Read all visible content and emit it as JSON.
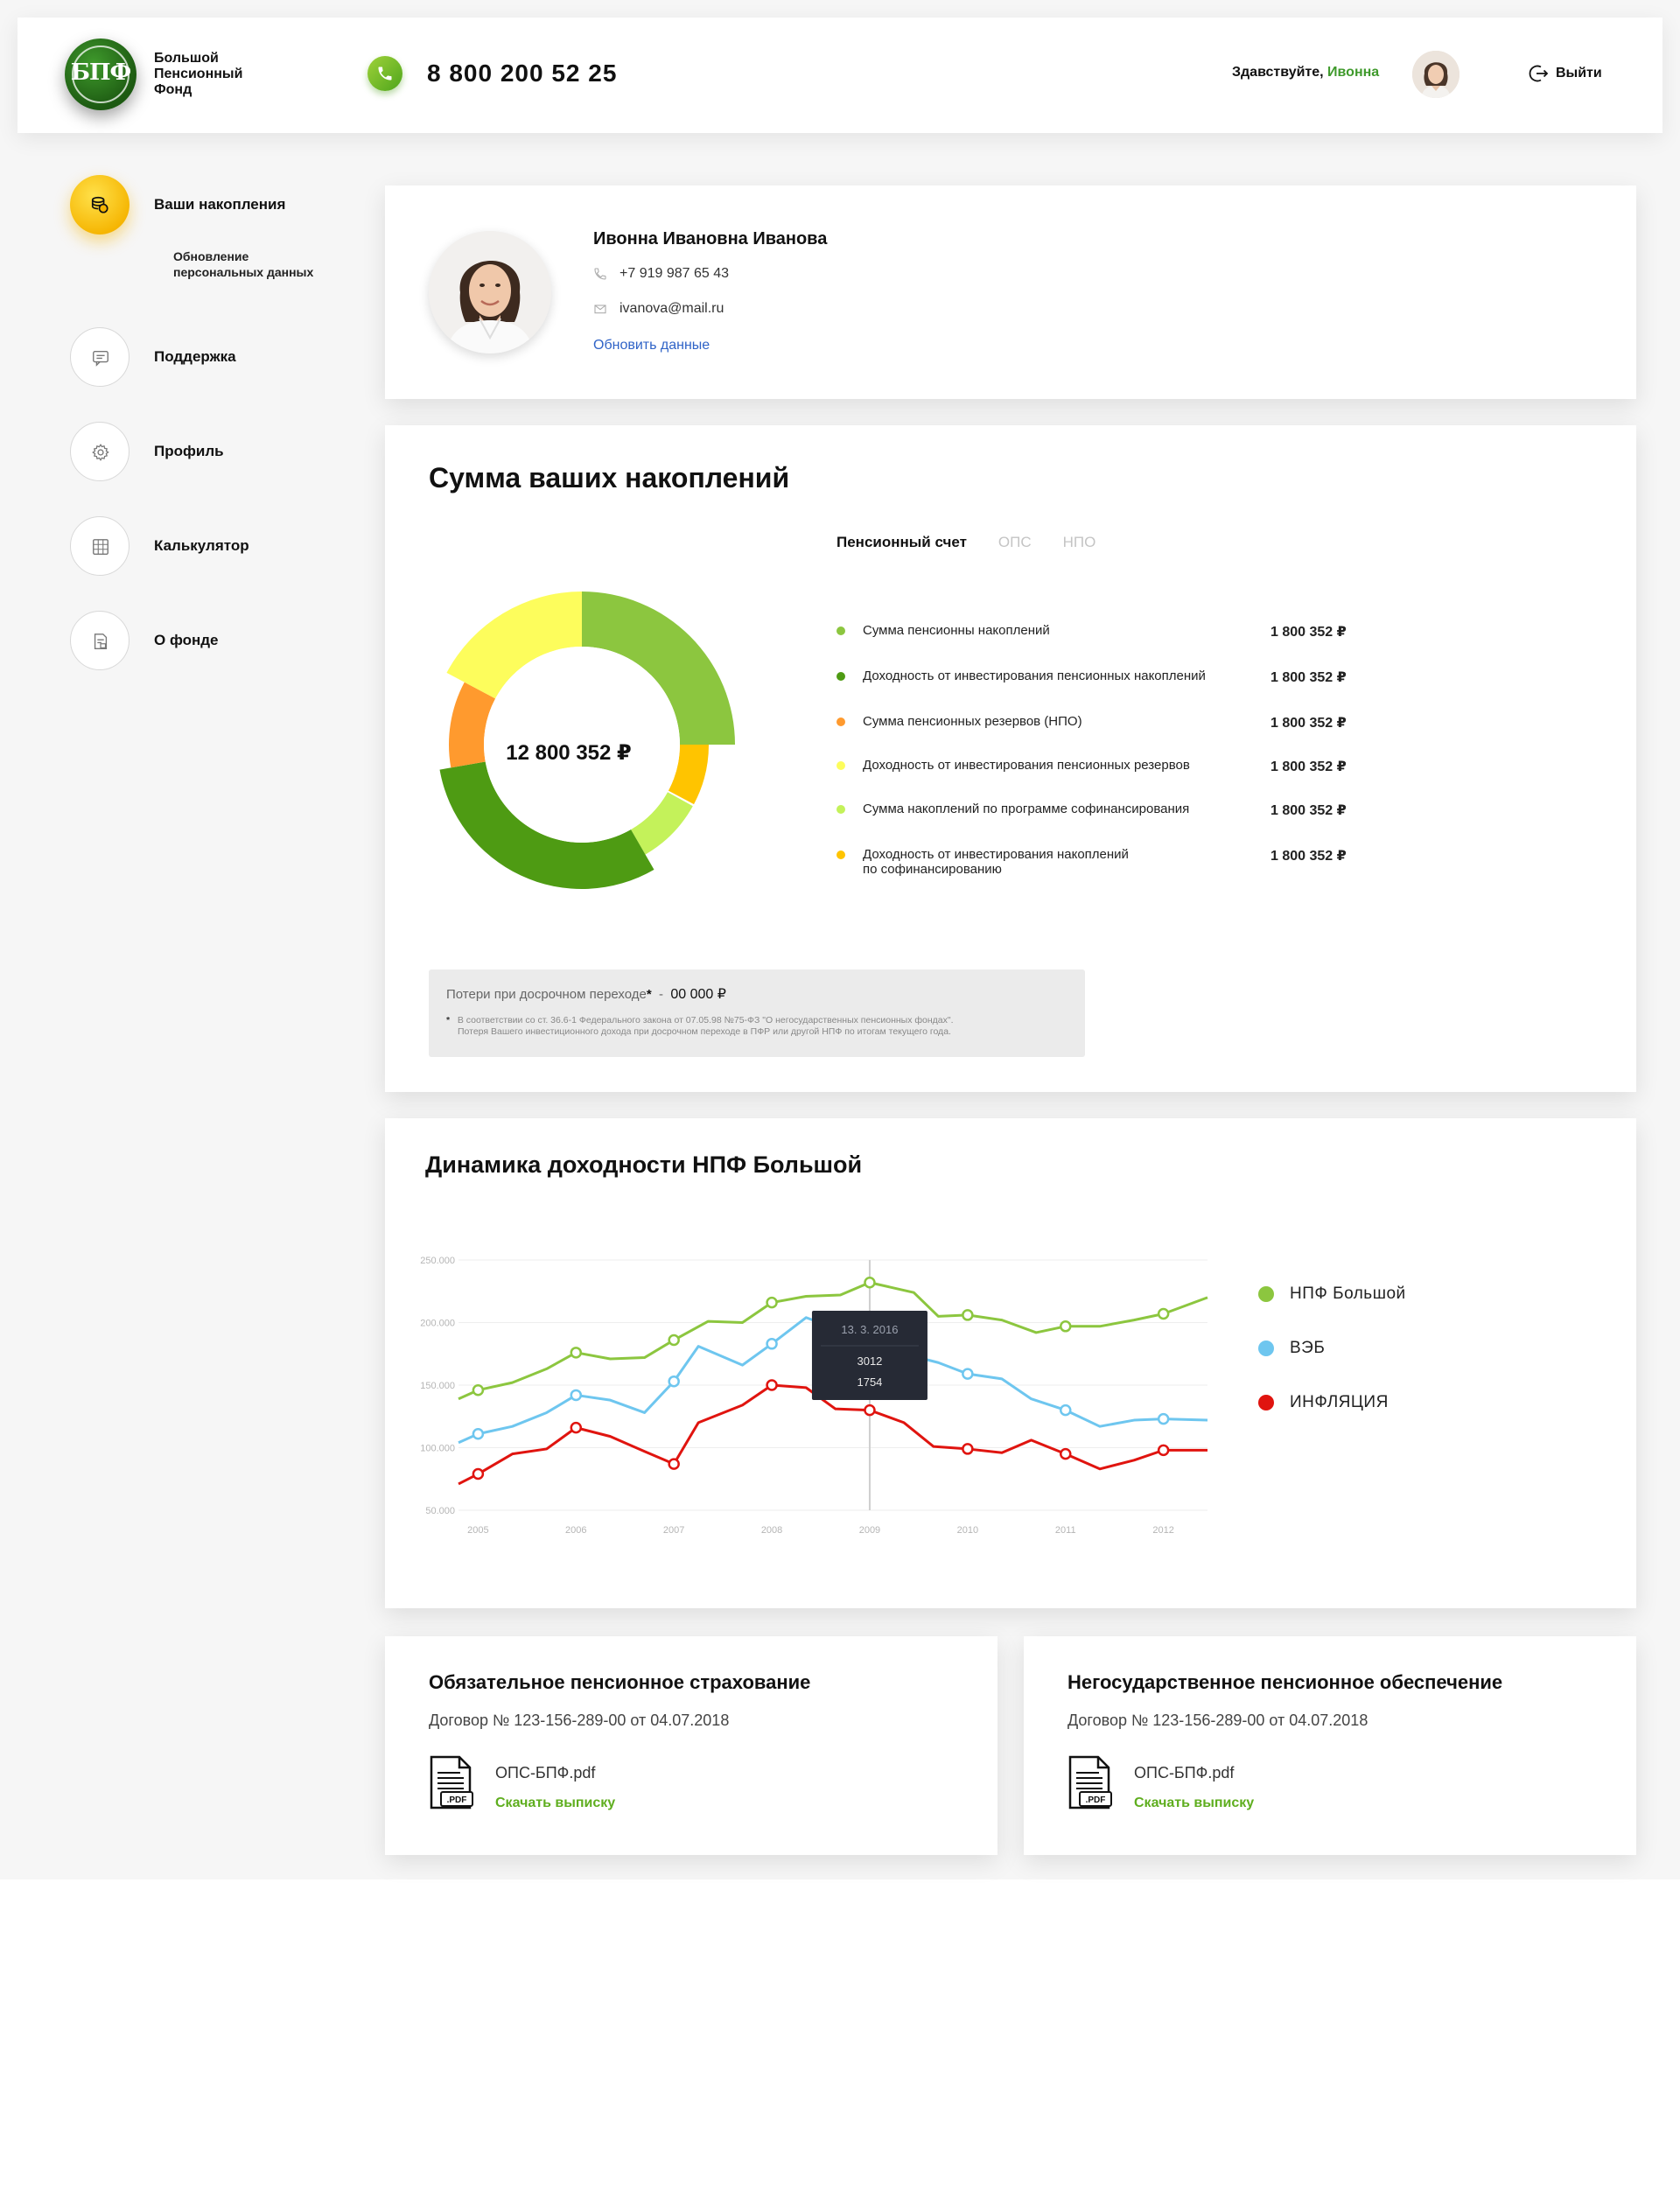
{
  "header": {
    "brand_lines": [
      "Большой",
      "Пенсионный",
      "Фонд"
    ],
    "logo_mark": "БПФ",
    "phone": "8 800 200 52 25",
    "greeting": "Здавствуйте, ",
    "user_first_name": "Ивонна",
    "logout_label": "Выйти"
  },
  "sidebar": {
    "items": [
      {
        "label": "Ваши накопления",
        "icon": "coins-icon",
        "active": true
      },
      {
        "label": "Поддержка",
        "icon": "chat-icon"
      },
      {
        "label": "Профиль",
        "icon": "gear-icon"
      },
      {
        "label": "Калькулятор",
        "icon": "calculator-icon"
      },
      {
        "label": "О фонде",
        "icon": "document-icon"
      }
    ],
    "subitem_lines": [
      "Обновление",
      "персональных данных"
    ]
  },
  "profile": {
    "full_name": "Ивонна Ивановна Иванова",
    "phone": "+7 919 987 65 43",
    "email": "ivanova@mail.ru",
    "update_link": "Обновить данные"
  },
  "savings": {
    "title": "Сумма ваших накоплений",
    "tabs": [
      {
        "label": "Пенсионный счет",
        "active": true
      },
      {
        "label": "ОПС",
        "active": false
      },
      {
        "label": "НПО",
        "active": false
      }
    ],
    "total": "12 800 352 ₽",
    "items": [
      {
        "label": "Сумма пенсионны накоплений",
        "value": "1 800 352 ₽",
        "color": "#8cc63f"
      },
      {
        "label": "Доходность от инвестирования пенсионных накоплений",
        "value": "1 800 352 ₽",
        "color": "#4e9b13"
      },
      {
        "label": "Сумма пенсионных резервов (НПО)",
        "value": "1 800 352 ₽",
        "color": "#ff9a2e"
      },
      {
        "label": "Доходность от инвестирования пенсионных резервов",
        "value": "1 800 352 ₽",
        "color": "#fdfd5c"
      },
      {
        "label": "Сумма накоплений по программе софинансирования",
        "value": "1 800 352 ₽",
        "color": "#c4f25a"
      },
      {
        "label": "Доходность от инвестирования накоплений по софинансированию",
        "value": "1 800 352 ₽",
        "color": "#ffc400",
        "lines": [
          "Доходность от инвестирования накоплений",
          "по софинансированию"
        ]
      }
    ],
    "loss_label": "Потери при досрочном переходе",
    "loss_mark": "*",
    "loss_sep": "  -  ",
    "loss_value": "00 000 ₽",
    "loss_note_lines": [
      "В соответствии со ст. 36.6-1 Федерального закона от 07.05.98 №75-ФЗ \"О негосударственных пенсионных фондах\".",
      "Потеря Вашего инвестиционного дохода при досрочном переходе в ПФР или другой НПФ по итогам текущего года."
    ]
  },
  "dynamics": {
    "title": "Динамика доходности НПФ Большой",
    "tooltip": {
      "date": "13. 3. 2016",
      "v1": "3012",
      "v2": "1754"
    }
  },
  "chart_data": {
    "type": "line",
    "title": "Динамика доходности НПФ Большой",
    "xlabel": "",
    "ylabel": "",
    "x_ticks": [
      "2005",
      "2006",
      "2007",
      "2008",
      "2009",
      "2010",
      "2011",
      "2012"
    ],
    "y_ticks": [
      "50.000",
      "100.000",
      "150.000",
      "200.000",
      "250.000"
    ],
    "xlim": [
      2004.8,
      2012.45
    ],
    "ylim": [
      50000,
      250000
    ],
    "grid": true,
    "legend_position": "right",
    "series": [
      {
        "name": "НПФ Большой",
        "color": "#8cc63f",
        "x": [
          2004.8,
          2005.0,
          2005.35,
          2005.7,
          2006.0,
          2006.35,
          2006.7,
          2007.0,
          2007.35,
          2007.7,
          2008.0,
          2008.35,
          2008.7,
          2009.0,
          2009.45,
          2009.7,
          2010.0,
          2010.35,
          2010.7,
          2011.0,
          2011.35,
          2011.7,
          2012.0,
          2012.45
        ],
        "y": [
          139000,
          146000,
          152000,
          163000,
          176000,
          171000,
          172000,
          186000,
          201000,
          200000,
          216000,
          221000,
          222000,
          232000,
          224000,
          205000,
          206000,
          202000,
          192000,
          197000,
          197000,
          202000,
          207000,
          220000
        ],
        "markers": [
          2005.0,
          2006.0,
          2007.0,
          2008.0,
          2009.0,
          2010.0,
          2011.0,
          2012.0
        ]
      },
      {
        "name": "ВЭБ",
        "color": "#6ec6ef",
        "x": [
          2004.8,
          2005.0,
          2005.35,
          2005.7,
          2006.0,
          2006.35,
          2006.7,
          2007.0,
          2007.25,
          2007.7,
          2008.0,
          2008.35,
          2009.3,
          2009.7,
          2010.0,
          2010.35,
          2010.65,
          2011.0,
          2011.35,
          2011.7,
          2012.0,
          2012.45
        ],
        "y": [
          104000,
          111000,
          117000,
          128000,
          142000,
          138000,
          128000,
          153000,
          181000,
          166000,
          183000,
          204000,
          176000,
          168000,
          159000,
          155000,
          139000,
          130000,
          117000,
          122000,
          123000,
          122000
        ],
        "markers": [
          2005.0,
          2006.0,
          2007.0,
          2008.0,
          2010.0,
          2011.0,
          2012.0
        ]
      },
      {
        "name": "ИНФЛЯЦИЯ",
        "color": "#e0140f",
        "x": [
          2004.8,
          2005.0,
          2005.35,
          2005.7,
          2006.0,
          2006.35,
          2006.7,
          2007.0,
          2007.25,
          2007.7,
          2008.0,
          2008.35,
          2008.65,
          2009.0,
          2009.35,
          2009.65,
          2010.0,
          2010.35,
          2010.65,
          2011.0,
          2011.35,
          2011.7,
          2012.0,
          2012.45
        ],
        "y": [
          71000,
          79000,
          95000,
          99000,
          116000,
          109000,
          97000,
          87000,
          120000,
          134000,
          150000,
          148000,
          131000,
          130000,
          120000,
          101000,
          99000,
          96000,
          106000,
          95000,
          83000,
          90000,
          98000,
          98000
        ],
        "markers": [
          2005.0,
          2006.0,
          2007.0,
          2008.0,
          2009.0,
          2010.0,
          2011.0,
          2012.0
        ]
      }
    ],
    "highlight_x": 2009.0
  },
  "documents": [
    {
      "title": "Обязательное пенсионное страхование",
      "contract": "Договор № 123-156-289-00 от 04.07.2018",
      "file": "ОПС-БПФ.pdf",
      "file_badge": ".PDF",
      "download": "Скачать выписку"
    },
    {
      "title": "Негосударственное пенсионное обеспечение",
      "contract": "Договор № 123-156-289-00 от 04.07.2018",
      "file": "ОПС-БПФ.pdf",
      "file_badge": ".PDF",
      "download": "Скачать выписку"
    }
  ]
}
